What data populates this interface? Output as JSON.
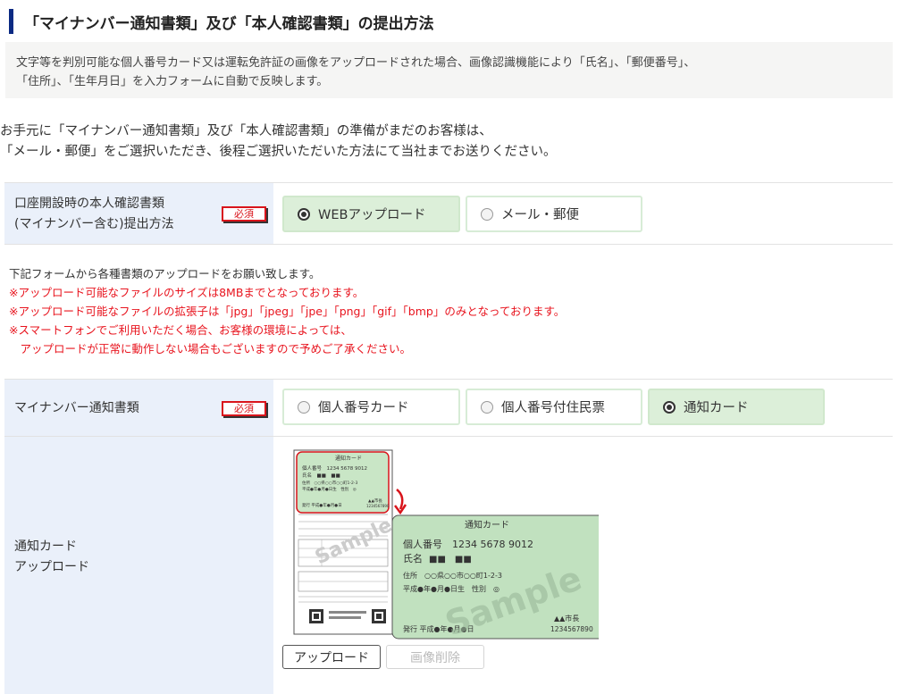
{
  "section": {
    "title": "「マイナンバー通知書類」及び「本人確認書類」の提出方法",
    "info_lines": [
      "文字等を判別可能な個人番号カード又は運転免許証の画像をアップロードされた場合、画像認識機能により「氏名」、「郵便番号」、",
      "「住所」、「生年月日」を入力フォームに自動で反映します。"
    ]
  },
  "intro_lines": [
    "お手元に「マイナンバー通知書類」及び「本人確認書類」の準備がまだのお客様は、",
    "「メール・郵便」をご選択いただき、後程ご選択いただいた方法にて当社までお送りください。"
  ],
  "submission_row": {
    "label_lines": [
      "口座開設時の本人確認書類",
      "(マイナンバー含む)提出方法"
    ],
    "required": "必須",
    "options": [
      {
        "label": "WEBアップロード",
        "selected": true
      },
      {
        "label": "メール・郵便",
        "selected": false
      }
    ]
  },
  "notes": {
    "normal": "下記フォームから各種書類のアップロードをお願い致します。",
    "red": [
      "※アップロード可能なファイルのサイズは8MBまでとなっております。",
      "※アップロード可能なファイルの拡張子は「jpg」「jpeg」「jpe」「png」「gif」「bmp」のみとなっております。",
      "※スマートフォンでご利用いただく場合、お客様の環境によっては、",
      "　アップロードが正常に動作しない場合もございますので予めご了承ください。"
    ]
  },
  "mynumber_row": {
    "label": "マイナンバー通知書類",
    "required": "必須",
    "options": [
      {
        "label": "個人番号カード",
        "selected": false
      },
      {
        "label": "個人番号付住民票",
        "selected": false
      },
      {
        "label": "通知カード",
        "selected": true
      }
    ]
  },
  "upload_row": {
    "label_lines": [
      "通知カード",
      "アップロード"
    ],
    "sample": {
      "card_title": "通知カード",
      "number_label": "個人番号",
      "number": "1234 5678 9012",
      "name_label": "氏名",
      "name_value": "■■　■■",
      "address": "住所　○○県○○市○○町1-2-3",
      "birth": "平成●年●月●日生　性別　◎",
      "mayor": "▲▲市長",
      "issued": "発行 平成●年●月●日",
      "serial": "1234567890",
      "watermark": "Sample",
      "mini_card_title": "通知カード",
      "mini_number": "個人番号　1234 5678 9012",
      "mini_name": "氏名　■■　■■",
      "mini_address": "住所　○○県○○市○○町1-2-3",
      "mini_birth": "平成●年●月●日生　性別　◎",
      "mini_issued": "発行 平成●年●月●日",
      "mini_mayor": "▲▲市長",
      "mini_serial": "1234567890"
    },
    "upload_button": "アップロード",
    "delete_button": "画像削除"
  },
  "colors": {
    "title_bar": "#0b2a83",
    "required_red": "#d9141b",
    "notice_red": "#e8141e",
    "label_bg": "#eaf0fa",
    "option_selected_bg": "#dcefd9",
    "card_green": "#c1e1bf"
  }
}
